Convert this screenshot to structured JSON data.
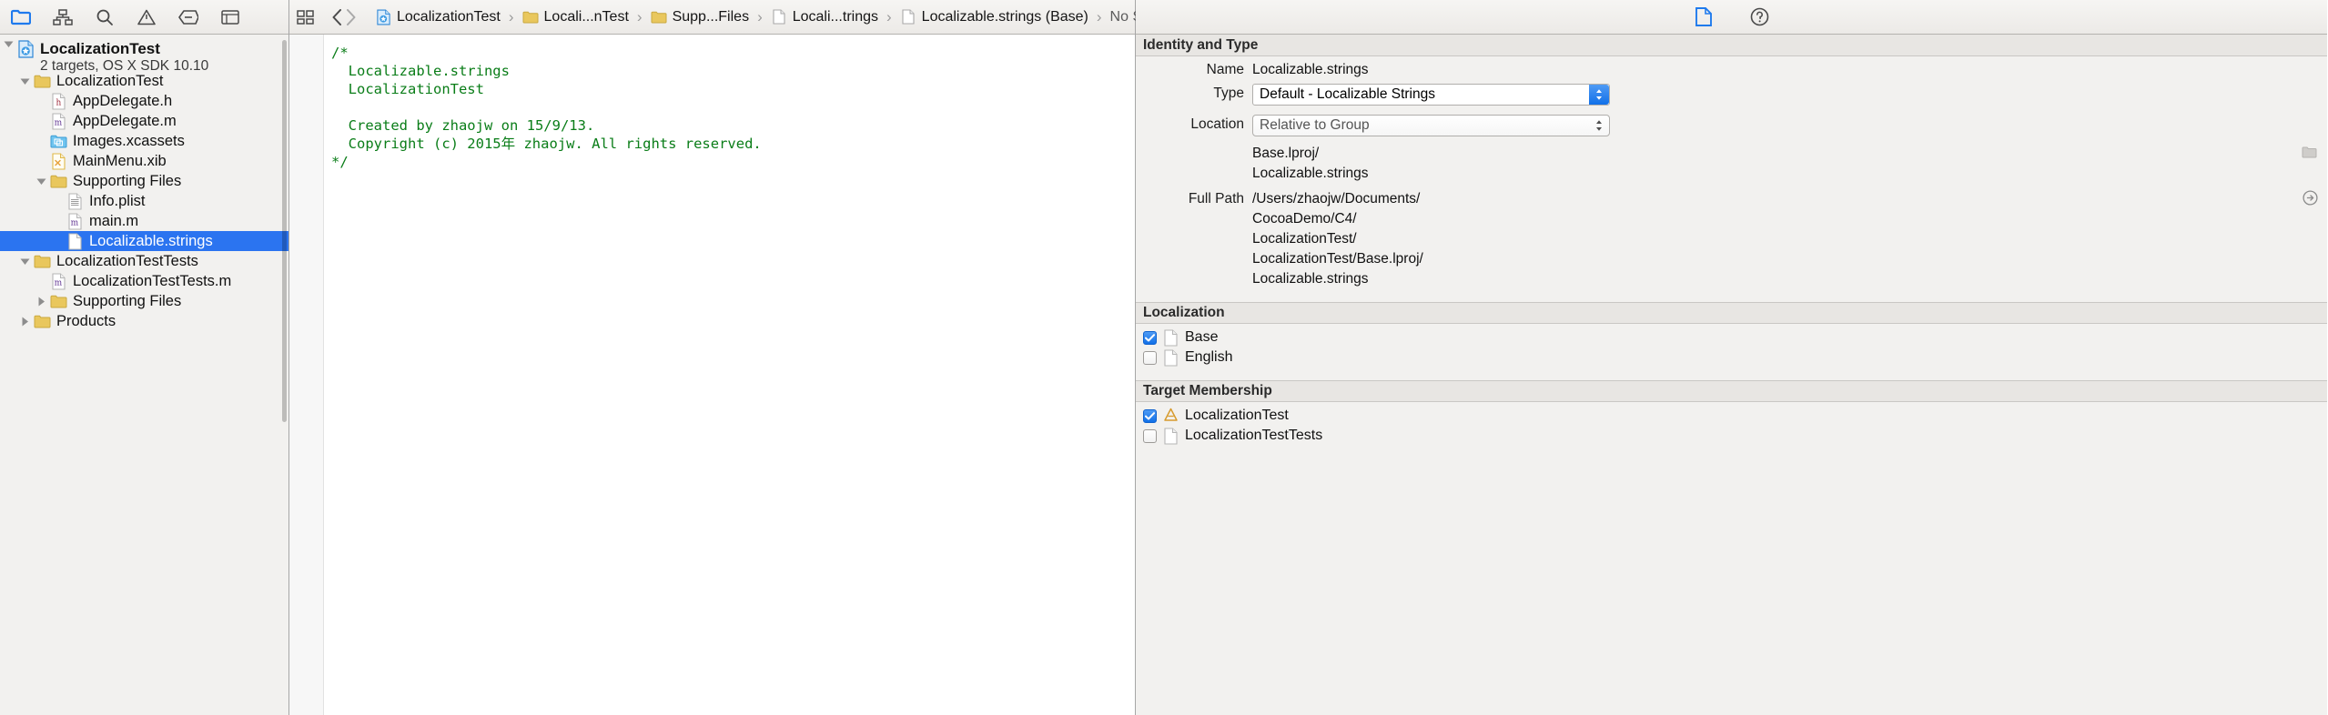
{
  "navigator": {
    "toolbar_icons": [
      {
        "name": "folder-icon",
        "active": true
      },
      {
        "name": "source-control-icon",
        "active": false
      },
      {
        "name": "search-icon",
        "active": false
      },
      {
        "name": "warning-triangle-icon",
        "active": false
      },
      {
        "name": "breakpoint-icon",
        "active": false
      },
      {
        "name": "report-icon",
        "active": false
      },
      {
        "name": "tag-icon",
        "active": false
      },
      {
        "name": "comment-icon",
        "active": false
      }
    ],
    "project": {
      "name": "LocalizationTest",
      "subtitle": "2 targets, OS X SDK 10.10",
      "icon": "xcode-project-icon"
    },
    "tree": [
      {
        "label": "LocalizationTest",
        "icon": "folder-yellow-icon",
        "indent": 1,
        "twisty": "down",
        "selected": false
      },
      {
        "label": "AppDelegate.h",
        "icon": "header-file-icon",
        "indent": 2,
        "twisty": "none",
        "selected": false
      },
      {
        "label": "AppDelegate.m",
        "icon": "objc-file-icon",
        "indent": 2,
        "twisty": "none",
        "selected": false
      },
      {
        "label": "Images.xcassets",
        "icon": "xcassets-icon",
        "indent": 2,
        "twisty": "none",
        "selected": false
      },
      {
        "label": "MainMenu.xib",
        "icon": "xib-file-icon",
        "indent": 2,
        "twisty": "none",
        "selected": false
      },
      {
        "label": "Supporting Files",
        "icon": "folder-yellow-icon",
        "indent": 2,
        "twisty": "down",
        "selected": false
      },
      {
        "label": "Info.plist",
        "icon": "plist-file-icon",
        "indent": 3,
        "twisty": "none",
        "selected": false
      },
      {
        "label": "main.m",
        "icon": "objc-file-icon",
        "indent": 3,
        "twisty": "none",
        "selected": false
      },
      {
        "label": "Localizable.strings",
        "icon": "strings-file-icon",
        "indent": 3,
        "twisty": "none",
        "selected": true
      },
      {
        "label": "LocalizationTestTests",
        "icon": "folder-yellow-icon",
        "indent": 1,
        "twisty": "down",
        "selected": false
      },
      {
        "label": "LocalizationTestTests.m",
        "icon": "objc-file-icon",
        "indent": 2,
        "twisty": "none",
        "selected": false
      },
      {
        "label": "Supporting Files",
        "icon": "folder-yellow-icon",
        "indent": 2,
        "twisty": "right",
        "selected": false
      },
      {
        "label": "Products",
        "icon": "folder-yellow-icon",
        "indent": 1,
        "twisty": "right",
        "selected": false
      }
    ]
  },
  "editor": {
    "jumpbar_icons": [
      {
        "name": "related-items-icon"
      },
      {
        "name": "back-arrow-icon"
      },
      {
        "name": "forward-arrow-icon"
      }
    ],
    "breadcrumbs": [
      {
        "label": "LocalizationTest",
        "icon": "xcode-project-icon"
      },
      {
        "label": "Locali...nTest",
        "icon": "folder-yellow-icon"
      },
      {
        "label": "Supp...Files",
        "icon": "folder-yellow-icon"
      },
      {
        "label": "Locali...trings",
        "icon": "strings-file-icon"
      },
      {
        "label": "Localizable.strings (Base)",
        "icon": "strings-file-icon"
      },
      {
        "label": "No Selection",
        "icon": "none"
      }
    ],
    "code": "/*\n  Localizable.strings\n  LocalizationTest\n\n  Created by zhaojw on 15/9/13.\n  Copyright (c) 2015年 zhaojw. All rights reserved.\n*/",
    "code_color": "#0a7d18"
  },
  "inspector": {
    "toolbar_icons": [
      {
        "name": "file-inspector-icon",
        "active": true
      },
      {
        "name": "quick-help-icon",
        "active": false
      }
    ],
    "identity_section": {
      "title": "Identity and Type",
      "name_label": "Name",
      "name_value": "Localizable.strings",
      "type_label": "Type",
      "type_value": "Default - Localizable Strings",
      "location_label": "Location",
      "location_value": "Relative to Group",
      "relative_path": "Base.lproj/\nLocalizable.strings",
      "full_path_label": "Full Path",
      "full_path": "/Users/zhaojw/Documents/\nCocoaDemo/C4/\nLocalizationTest/\nLocalizationTest/Base.lproj/\nLocalizable.strings"
    },
    "localization_section": {
      "title": "Localization",
      "items": [
        {
          "label": "Base",
          "checked": true,
          "icon": "strings-file-icon"
        },
        {
          "label": "English",
          "checked": false,
          "icon": "strings-file-icon"
        }
      ]
    },
    "target_membership_section": {
      "title": "Target Membership",
      "items": [
        {
          "label": "LocalizationTest",
          "checked": true,
          "icon": "target-app-icon"
        },
        {
          "label": "LocalizationTestTests",
          "checked": false,
          "icon": "target-test-icon"
        }
      ]
    }
  },
  "colors": {
    "accent_blue": "#2b74f0",
    "comment_green": "#0a7d18",
    "folder_yellow": "#e8c65c",
    "chrome_gray": "#f2f1ef"
  }
}
